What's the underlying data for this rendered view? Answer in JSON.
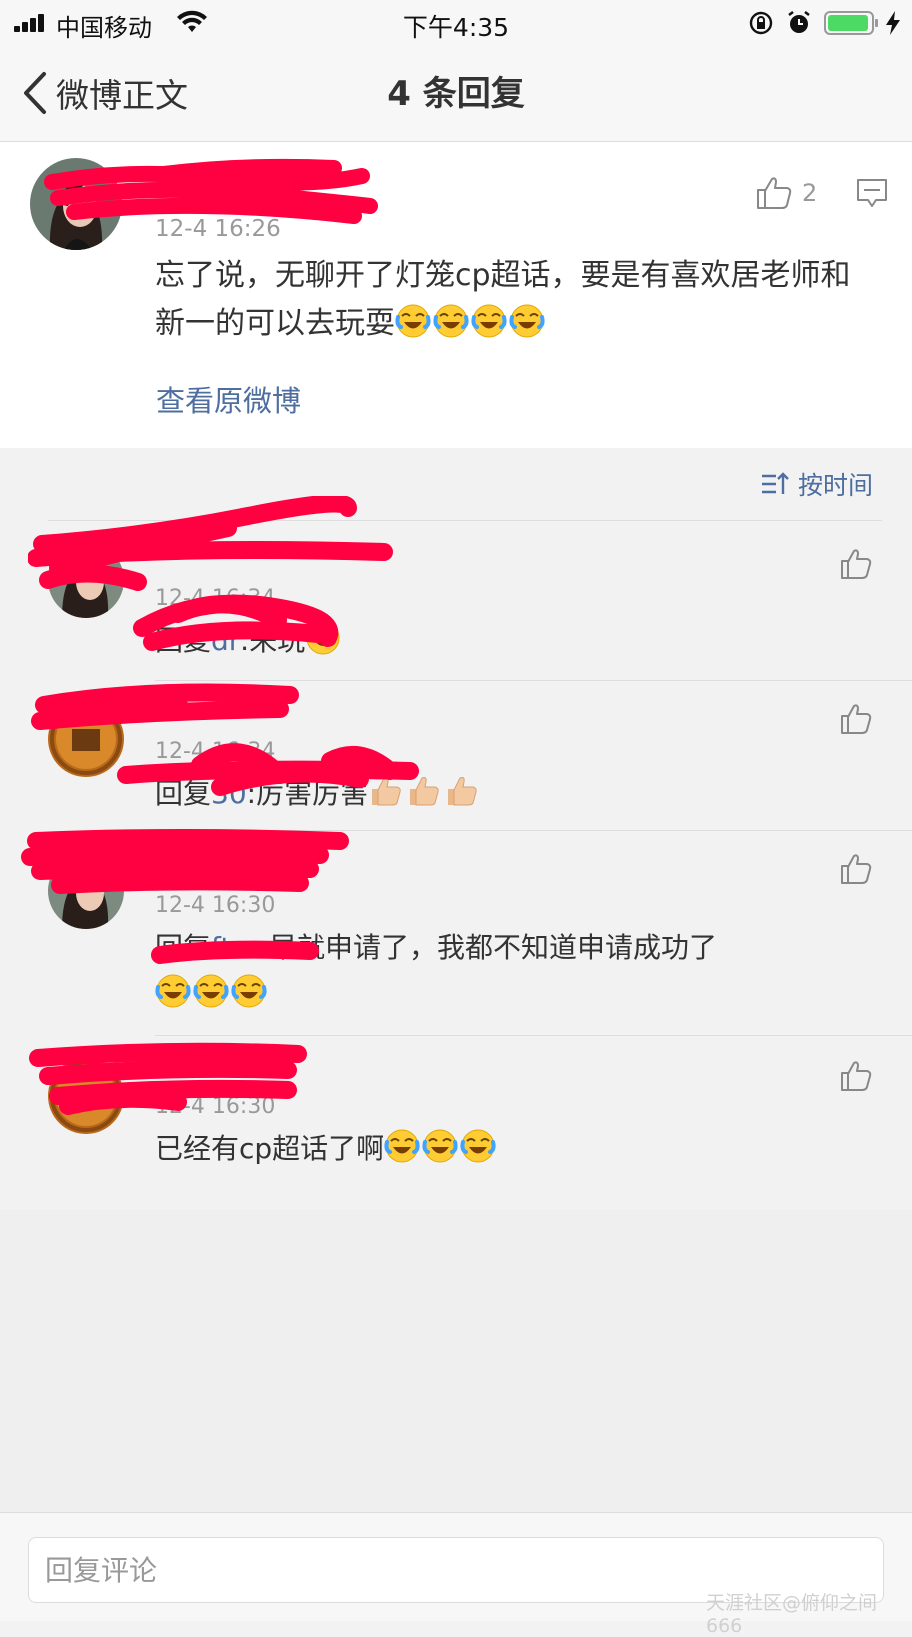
{
  "status_bar": {
    "carrier": "中国移动",
    "time": "下午4:35",
    "battery_color": "#4cd964"
  },
  "nav": {
    "back_label": "微博正文",
    "title": "4 条回复"
  },
  "original_comment": {
    "username": "",
    "time": "12-4 16:26",
    "text": "忘了说，无聊开了灯笼cp超话，要是有喜欢居老师和新一的可以去玩耍",
    "emoji": "laughing-crying-face",
    "emoji_count": 4,
    "like_count": "2",
    "view_original_label": "查看原微博"
  },
  "sort": {
    "label": "按时间"
  },
  "replies": [
    {
      "time": "12-4 16:34",
      "prefix": "回复",
      "mention": "dr",
      "text": ":来玩",
      "emoji": "grinning-face",
      "emoji_count": 1
    },
    {
      "time": "12-4 16:34",
      "prefix": "回复",
      "mention": "30",
      "text": ":厉害厉害",
      "emoji": "thumbs-up",
      "emoji_count": 3
    },
    {
      "time": "12-4 16:30",
      "prefix": "回复",
      "mention": "fter",
      "text": ":早就申请了，我都不知道申请成功了",
      "emoji": "laughing-crying-face",
      "emoji_count": 3
    },
    {
      "time": "12-4 16:30",
      "prefix": "",
      "mention": "",
      "text": "已经有cp超话了啊",
      "emoji": "laughing-crying-face",
      "emoji_count": 3
    }
  ],
  "bottom": {
    "reply_placeholder": "回复评论"
  },
  "watermark": "天涯社区@俯仰之间666",
  "colors": {
    "link": "#4d6e9e",
    "username": "#ff8200",
    "redaction": "#ff0040"
  }
}
